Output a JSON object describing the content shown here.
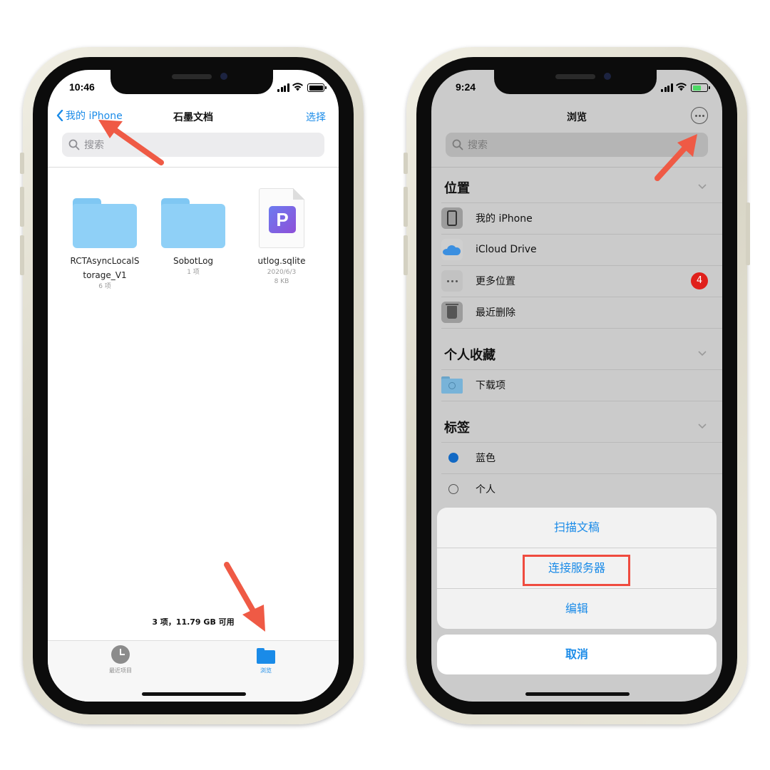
{
  "colors": {
    "accent": "#1a8be8",
    "arrow": "#ef5a45",
    "badge": "#e0201b",
    "tag_blue": "#1269c4",
    "folder": "#8fd0f7",
    "battery_green": "#4cd964"
  },
  "left_phone": {
    "status": {
      "time": "10:46"
    },
    "nav": {
      "back_label": "我的 iPhone",
      "title": "石墨文档",
      "select_label": "选择"
    },
    "search": {
      "placeholder": "搜索",
      "icon": "search-icon"
    },
    "files": [
      {
        "name_line1": "RCTAsyncLocalS",
        "name_line2": "torage_V1",
        "meta1": "6 项",
        "meta2": "",
        "icon": "folder-icon"
      },
      {
        "name_line1": "SobotLog",
        "name_line2": "",
        "meta1": "1 项",
        "meta2": "",
        "icon": "folder-icon"
      },
      {
        "name_line1": "utlog.sqlite",
        "name_line2": "",
        "meta1": "2020/6/3",
        "meta2": "8 KB",
        "icon": "document-icon",
        "app_letter": "P"
      }
    ],
    "footer_count": "3 项，11.79 GB 可用",
    "tabbar": [
      {
        "label": "最近项目",
        "icon": "clock-icon"
      },
      {
        "label": "浏览",
        "icon": "folder-icon"
      }
    ]
  },
  "right_phone": {
    "status": {
      "time": "9:24"
    },
    "nav": {
      "title": "浏览",
      "more_icon": "ellipsis-circle-icon"
    },
    "search": {
      "placeholder": "搜索",
      "icon": "search-icon"
    },
    "sections": {
      "locations": {
        "title": "位置",
        "items": [
          {
            "label": "我的 iPhone",
            "icon": "iphone-icon"
          },
          {
            "label": "iCloud Drive",
            "icon": "icloud-icon"
          },
          {
            "label": "更多位置",
            "icon": "more-icon",
            "badge": "4"
          },
          {
            "label": "最近删除",
            "icon": "trash-icon"
          }
        ]
      },
      "favorites": {
        "title": "个人收藏",
        "items": [
          {
            "label": "下载项",
            "icon": "download-folder-icon"
          }
        ]
      },
      "tags": {
        "title": "标签",
        "items": [
          {
            "label": "蓝色",
            "icon": "blue-dot-icon"
          },
          {
            "label": "个人",
            "icon": "empty-circle-icon"
          }
        ]
      }
    },
    "action_sheet": {
      "items": [
        "扫描文稿",
        "连接服务器",
        "编辑"
      ],
      "highlighted": "连接服务器",
      "cancel": "取消"
    }
  }
}
